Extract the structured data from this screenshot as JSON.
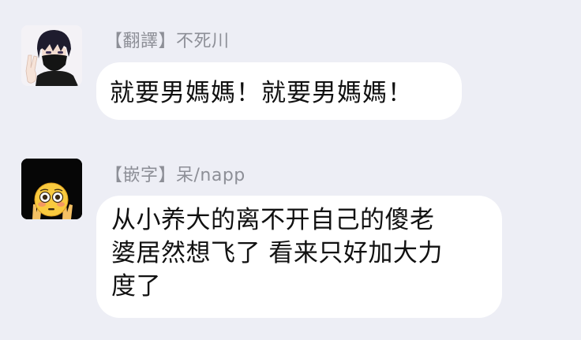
{
  "messages": [
    {
      "sender": "【翻譯】不死川",
      "avatar": "avatar-masked-boy-peace-sign",
      "lines": [
        "就要男媽媽！就要男媽媽！"
      ]
    },
    {
      "sender": "【嵌字】呆/napp",
      "avatar": "avatar-flushed-emoji-peace-hands",
      "lines": [
        "从小养大的离不开自己的傻老",
        "婆居然想飞了 看来只好加大力",
        "度了"
      ]
    }
  ],
  "colors": {
    "background": "#edeef5",
    "bubble": "#ffffff",
    "sender_text": "#8d8f97",
    "message_text": "#111111"
  }
}
